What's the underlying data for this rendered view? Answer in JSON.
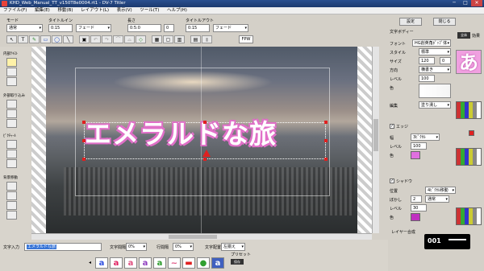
{
  "title": "KHD_Web_Manual_TT_v150T8e0004.rt1 - DV-7 Titler",
  "menu": [
    "ファイル(F)",
    "編集(E)",
    "移動(B)",
    "レイアウト(L)",
    "表示(V)",
    "ツール(T)",
    "ヘルプ(H)"
  ],
  "toolbar": {
    "mode_label": "モード",
    "mode_value": "通常",
    "title_in_label": "タイトルイン",
    "title_in_value": "0:15",
    "title_in_effect": "フェード",
    "length_label": "長さ",
    "length_value": "0:5:0",
    "length_value2": "0",
    "title_out_label": "タイトルアウト",
    "title_out_value": "0:15",
    "title_out_effect": "フェード",
    "fpw_label": "FPW",
    "settings_button": "設定",
    "close_button": "閉じる"
  },
  "left_groups": [
    "内部ﾃｷｽﾄ",
    "外部取り込み",
    "ﾋﾟｸﾁｬｰﾙ",
    "背景移動"
  ],
  "canvas": {
    "main_text": "エメラルドな旅"
  },
  "right": {
    "text_body_label": "文字ボディー",
    "font_label": "フォント",
    "font_value": "HG創英角ﾎﾟｯﾌﾟ体",
    "style_label": "スタイル",
    "style_value": "標準",
    "size_label": "サイズ",
    "size_value": "120",
    "size_value2": "0",
    "direction_label": "方向",
    "direction_value": "横書き",
    "level_label": "レベル",
    "level_value": "100",
    "color_label": "色",
    "edit_label": "編集",
    "edit_value": "塗り潰し",
    "edge_label": "エッジ",
    "width_label": "幅",
    "width_value": "3ﾋﾟｸｾﾙ",
    "edge_level_label": "レベル",
    "edge_level_value": "100",
    "edge_color_label": "色",
    "shadow_label": "シャドウ",
    "position_label": "位置",
    "position_value": "4ﾋﾟｸｾﾙ移動",
    "blur_label": "ぼかし",
    "blur_value": "2",
    "blur_mode": "通常",
    "shadow_level_label": "レベル",
    "shadow_level_value": "30",
    "shadow_color_label": "色",
    "layer_label": "レイヤー合成",
    "preview_char": "あ",
    "header_tabs": [
      "全体",
      "効果"
    ]
  },
  "counter": "001",
  "bottom": {
    "text_input_label": "文字入力",
    "text_input_value": "エメラルドな旅",
    "char_spacing_label": "文字間隔",
    "char_spacing_value": "0%",
    "line_spacing_label": "行間隔",
    "line_spacing_value": "0%",
    "align_label": "文字配置",
    "align_value": "左揃え",
    "preset_label": "プリセット",
    "preset_save": "保存"
  },
  "colors": {
    "accent_pink": "#e070c8",
    "title_bar": "#1c3a6e"
  }
}
